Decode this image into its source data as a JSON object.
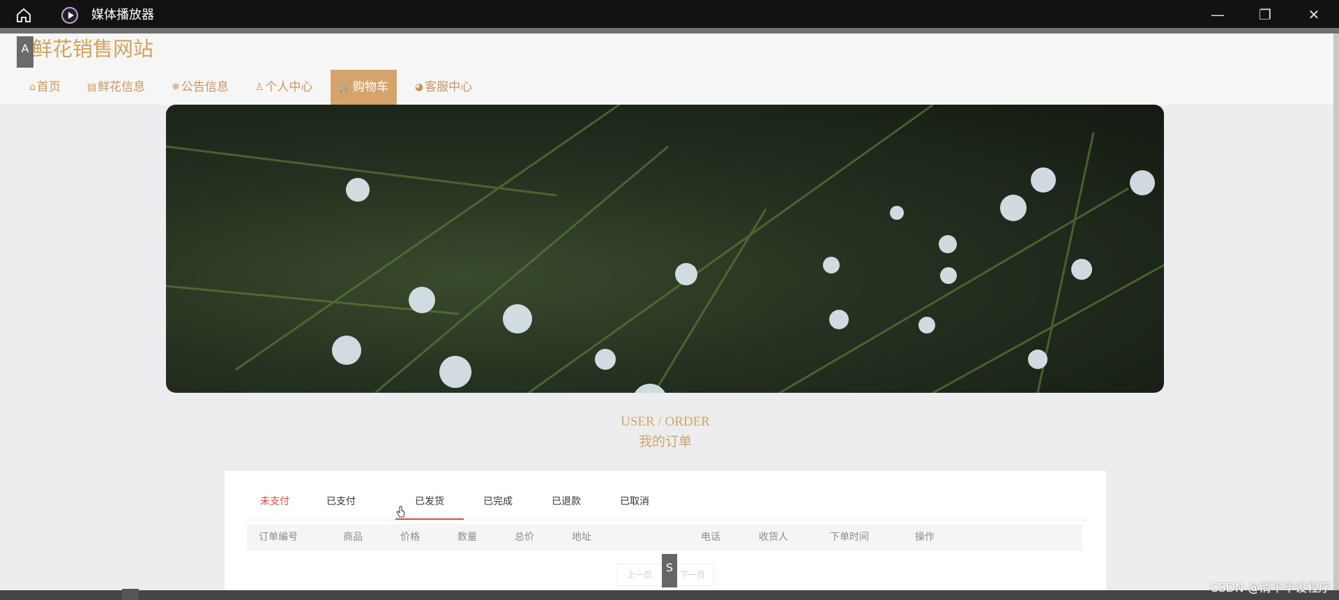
{
  "window": {
    "title": "媒体播放器",
    "minimize_glyph": "—",
    "restore_glyph": "❐",
    "close_glyph": "✕"
  },
  "marker_a": "A",
  "marker_s": "S",
  "site": {
    "title": "鲜花销售网站",
    "nav": [
      {
        "label": "首页",
        "icon": "⌂"
      },
      {
        "label": "鲜花信息",
        "icon": "▤"
      },
      {
        "label": "公告信息",
        "icon": "❄"
      },
      {
        "label": "个人中心",
        "icon": "♙"
      },
      {
        "label": "购物车",
        "icon": "🛒"
      },
      {
        "label": "客服中心",
        "icon": "◕"
      }
    ]
  },
  "section": {
    "en": "USER / ORDER",
    "cn": "我的订单"
  },
  "tabs": [
    "未支付",
    "已支付",
    "已发货",
    "已完成",
    "已退款",
    "已取消"
  ],
  "columns": [
    "订单编号",
    "商品",
    "价格",
    "数量",
    "总价",
    "地址",
    "电话",
    "收货人",
    "下单时间",
    "操作"
  ],
  "pager": {
    "prev": "上一页",
    "next": "下一页"
  },
  "watermark": "CSDN @清平毕设程序",
  "colors": {
    "accent": "#d6a46a",
    "active_tab": "#e6453b"
  }
}
